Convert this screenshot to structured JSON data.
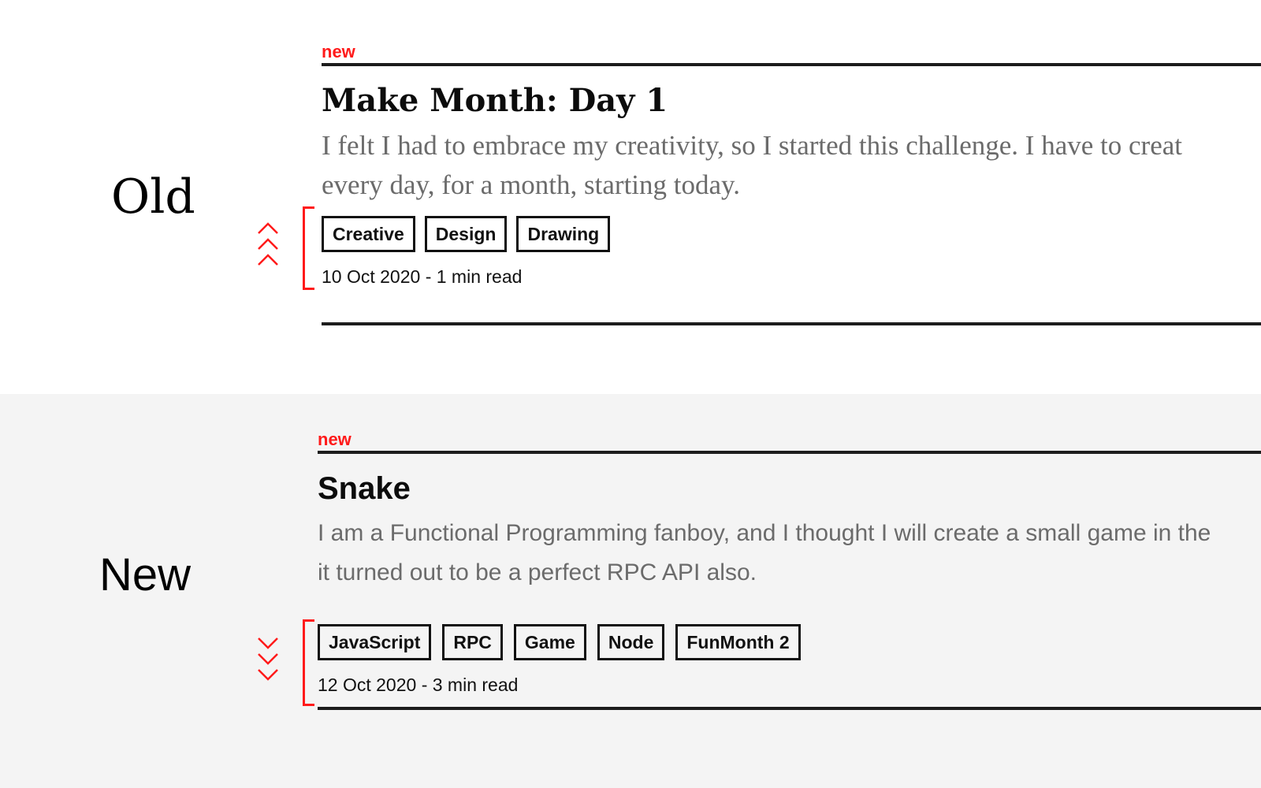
{
  "accent_color": "#ff1a1a",
  "old": {
    "label": "Old",
    "indicator": "chevrons-up-icon",
    "post": {
      "badge": "new",
      "title": "Make Month: Day 1",
      "excerpt_line1": "I felt I had to embrace my creativity, so I started this challenge. I have to creat",
      "excerpt_line2": "every day, for a month, starting today.",
      "tags": [
        "Creative",
        "Design",
        "Drawing"
      ],
      "meta": "10 Oct 2020 - 1 min read"
    }
  },
  "new": {
    "label": "New",
    "indicator": "chevrons-down-icon",
    "post": {
      "badge": "new",
      "title": "Snake",
      "excerpt_line1": "I am a Functional Programming fanboy, and I thought I will create a small game in the",
      "excerpt_line2": "it turned out to be a perfect RPC API also.",
      "tags": [
        "JavaScript",
        "RPC",
        "Game",
        "Node",
        "FunMonth 2"
      ],
      "meta": "12 Oct 2020 - 3 min read"
    }
  }
}
